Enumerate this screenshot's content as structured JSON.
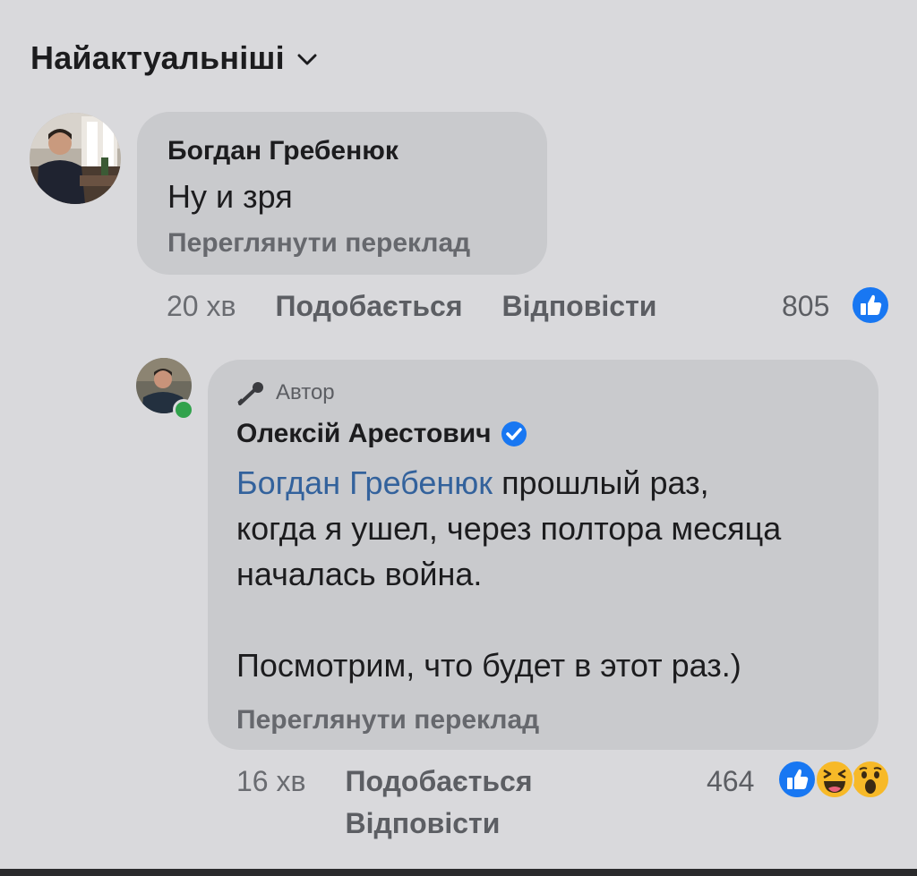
{
  "sort": {
    "label": "Найактуальніші"
  },
  "comments": [
    {
      "author": "Богдан Гребенюк",
      "text": "Ну и зря",
      "translate": "Переглянути переклад",
      "time": "20 хв",
      "like": "Подобається",
      "reply": "Відповісти",
      "reactions_count": "805",
      "reactions": [
        "like-icon"
      ]
    },
    {
      "badge": "Автор",
      "author": "Олексій Арестович",
      "mention": "Богдан Гребенюк",
      "text_line1": " прошлый раз,",
      "text_rest": "когда я ушел, через полтора месяца\nначалась война.\n\nПосмотрим, что будет в этот раз.)",
      "translate": "Переглянути переклад",
      "time": "16 хв",
      "like": "Подобається",
      "reply": "Відповісти",
      "reactions_count": "464",
      "reactions": [
        "like-icon",
        "haha-icon",
        "wow-icon"
      ]
    }
  ],
  "colors": {
    "background": "#d9d9dc",
    "bubble": "#c9cacd",
    "mention": "#33629c",
    "like_blue": "#1877f2",
    "verified_blue": "#1877f2",
    "online_green": "#31a24c",
    "emoji_yellow": "#f7b928"
  }
}
